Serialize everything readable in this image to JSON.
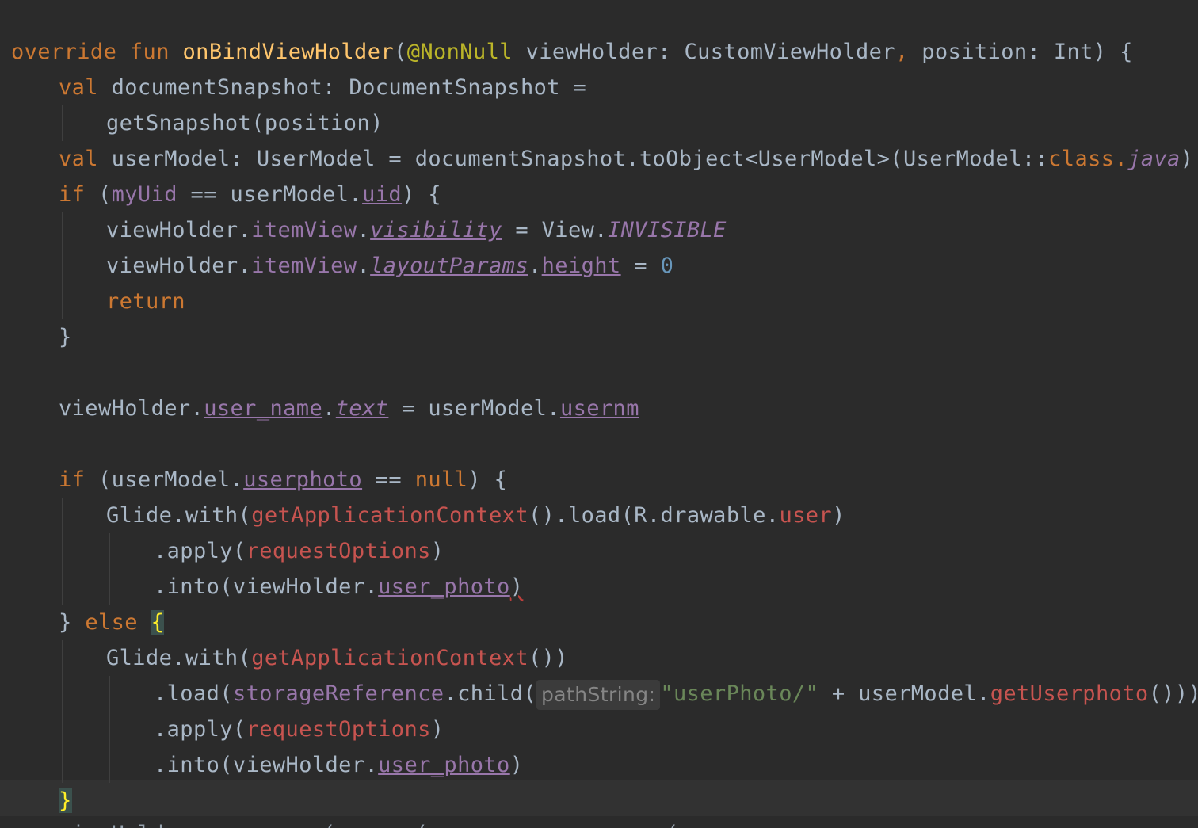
{
  "editor": {
    "background": "#2b2b2b",
    "colors": {
      "keyword": "#cc7832",
      "function": "#ffc66d",
      "annotation": "#bbb529",
      "property": "#9876aa",
      "unresolved": "#c75450",
      "string": "#6a8759",
      "number": "#6897bb",
      "default": "#a9b7c6"
    },
    "code": {
      "l1": {
        "override": "override",
        "fun": "fun",
        "name": "onBindViewHolder",
        "paren": "(",
        "annotation": "@NonNull",
        "params_a": " viewHolder: CustomViewHolder",
        "comma": ",",
        "params_b": " position: Int) {"
      },
      "l2": {
        "val": "val",
        "text": " documentSnapshot: DocumentSnapshot ="
      },
      "l3": {
        "text": "getSnapshot(position)"
      },
      "l4": {
        "val": "val",
        "text": " userModel: UserModel = documentSnapshot.toObject<UserModel>(UserModel::",
        "class_kw": "class",
        "dot": ".",
        "java": "java",
        "tail": ")!!"
      },
      "l5": {
        "if": "if",
        "open": " (",
        "myUid": "myUid",
        "mid": " == userModel.",
        "uid": "uid",
        "tail": ") {"
      },
      "l6": {
        "obj": "viewHolder.",
        "itemView": "itemView",
        "dot": ".",
        "visibility": "visibility",
        "mid": " = View.",
        "invisible": "INVISIBLE"
      },
      "l7": {
        "obj": "viewHolder.",
        "itemView": "itemView",
        "dot": ".",
        "layoutParams": "layoutParams",
        "dot2": ".",
        "height": "height",
        "mid": " = ",
        "zero": "0"
      },
      "l8": {
        "return": "return"
      },
      "l9": {
        "text": "}"
      },
      "l11": {
        "obj": "viewHolder.",
        "user_name": "user_name",
        "dot": ".",
        "text_prop": "text",
        "mid": " = userModel.",
        "usernm": "usernm"
      },
      "l13": {
        "if": "if",
        "open": " (userModel.",
        "userphoto": "userphoto",
        "mid": " == ",
        "null": "null",
        "tail": ") {"
      },
      "l14": {
        "a": "Glide.with(",
        "ctx": "getApplicationContext",
        "b": "().load(R.drawable.",
        "user": "user",
        "c": ")"
      },
      "l15": {
        "a": ".apply(",
        "opts": "requestOptions",
        "b": ")"
      },
      "l16": {
        "a": ".into(viewHolder.",
        "photo": "user_photo",
        "b": ")"
      },
      "l17": {
        "close": "} ",
        "else": "else",
        "space": " ",
        "brace": "{"
      },
      "l18": {
        "a": "Glide.with(",
        "ctx": "getApplicationContext",
        "b": "())"
      },
      "l19": {
        "a": ".load(",
        "ref": "storageReference",
        "b": ".child(",
        "hint": "pathString:",
        "str": "\"userPhoto/\"",
        "c": " + userModel.",
        "getter": "getUserphoto",
        "d": "()))"
      },
      "l20": {
        "a": ".apply(",
        "opts": "requestOptions",
        "b": ")"
      },
      "l21": {
        "a": ".into(viewHolder.",
        "photo": "user_photo",
        "b": ")"
      },
      "l22": {
        "brace": "}"
      },
      "l23": {
        "partial": "viewHolder.____  ___(  ____(_________  ___    (  ____ ____  ____"
      }
    }
  }
}
